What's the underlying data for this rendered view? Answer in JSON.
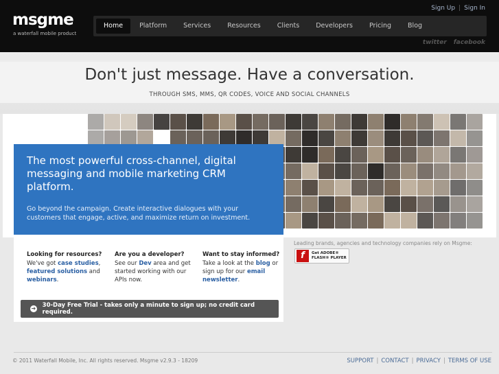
{
  "brand": {
    "logo": "msgme",
    "tagline": "a waterfall mobile product"
  },
  "topbar": {
    "sign_up": "Sign Up",
    "separator": "|",
    "sign_in": "Sign In"
  },
  "nav": {
    "items": [
      {
        "label": "Home",
        "active": true
      },
      {
        "label": "Platform"
      },
      {
        "label": "Services"
      },
      {
        "label": "Resources"
      },
      {
        "label": "Clients"
      },
      {
        "label": "Developers"
      },
      {
        "label": "Pricing"
      },
      {
        "label": "Blog"
      }
    ]
  },
  "social": {
    "twitter": "twitter",
    "facebook": "facebook"
  },
  "hero": {
    "headline": "Don't just message. Have a conversation.",
    "subline": "THROUGH SMS, MMS, QR CODES, VOICE AND SOCIAL CHANNELS"
  },
  "feature": {
    "title": "The most powerful cross-channel, digital messaging and mobile marketing CRM platform.",
    "text": "Go beyond the campaign. Create interactive dialogues with your customers that engage, active, and maximize return on investment."
  },
  "info": {
    "resources": {
      "heading": "Looking for resources?",
      "t1": "We've got ",
      "l1": "case studies",
      "t2": ", ",
      "l2": "featured solutions",
      "t3": " and ",
      "l3": "webinars",
      "t4": "."
    },
    "developer": {
      "heading": "Are you a developer?",
      "t1": "See our ",
      "l1": "Dev",
      "t2": " area and get started working with our APIs now."
    },
    "informed": {
      "heading": "Want to stay informed?",
      "t1": "Take a look at the ",
      "l1": "blog",
      "t2": " or sign up for our ",
      "l2": "email newsletter",
      "t3": "."
    },
    "trial": "30-Day Free Trial - takes only a minute to sign up; no credit card required."
  },
  "brands_text": "Leading brands, agencies and technology companies rely on Msgme:",
  "flash_badge": {
    "line1": "Get ADOBE®",
    "line2": "FLASH® PLAYER",
    "glyph": "f"
  },
  "footer": {
    "copyright": "© 2011 Waterfall Mobile, Inc. All rights reserved. Msgme v2.9.3 - 18209",
    "links": [
      "SUPPORT",
      "CONTACT",
      "PRIVACY",
      "TERMS OF USE"
    ]
  }
}
